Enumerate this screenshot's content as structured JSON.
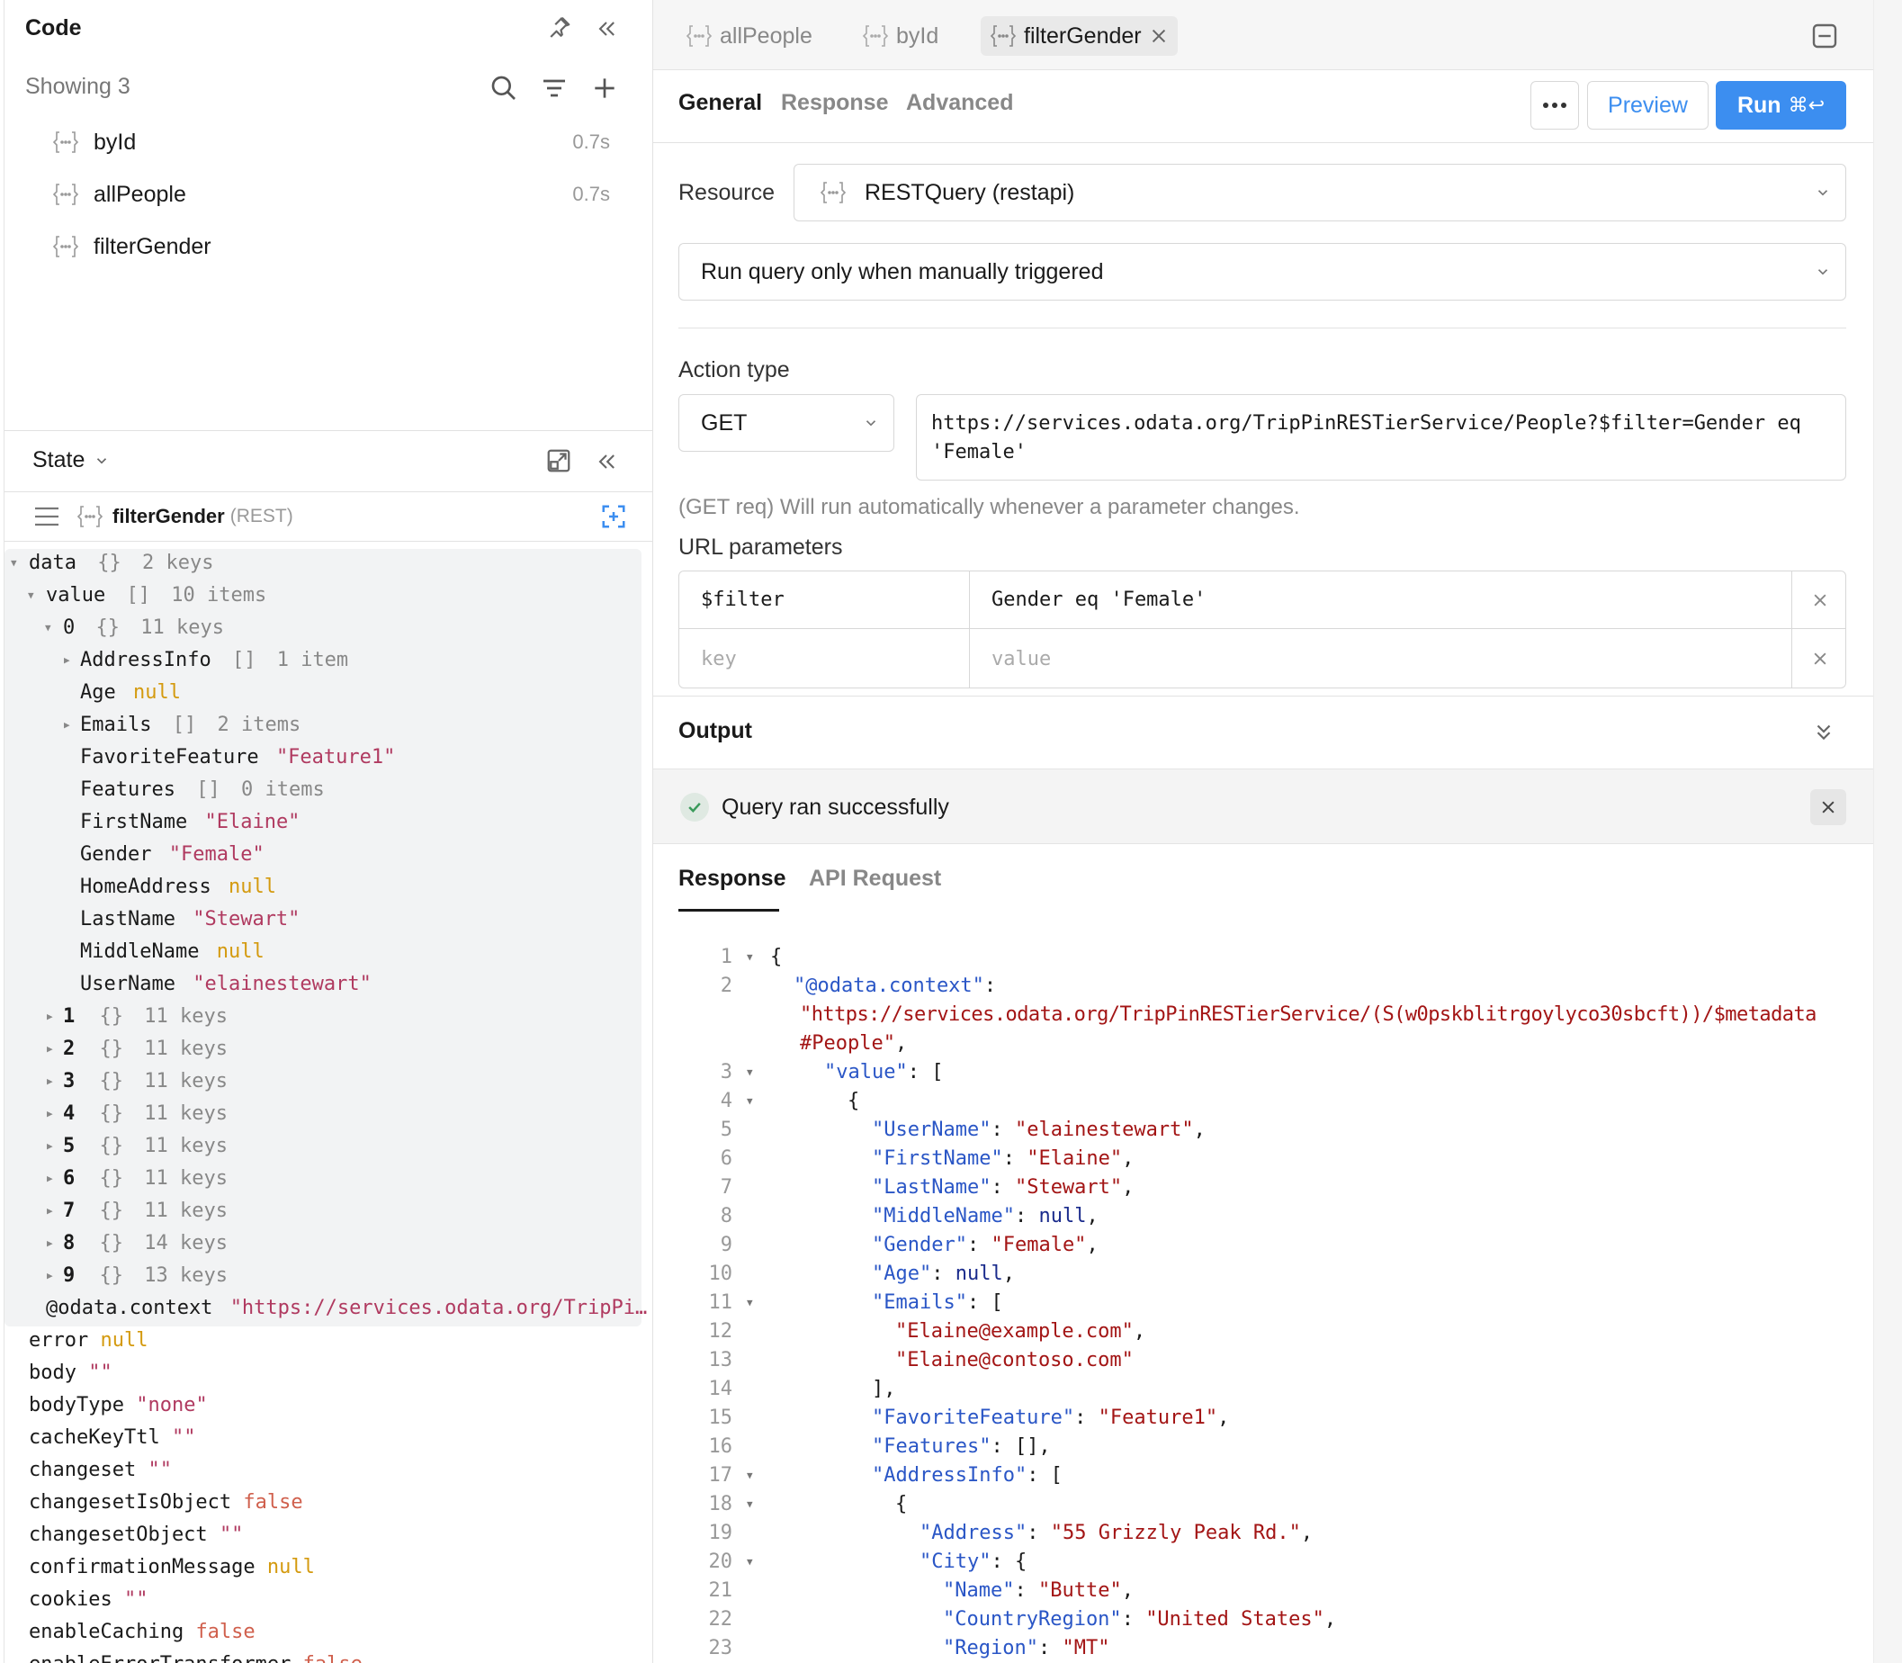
{
  "left": {
    "code_title": "Code",
    "showing": "Showing 3",
    "queries": [
      {
        "name": "byId",
        "time": "0.7s"
      },
      {
        "name": "allPeople",
        "time": "0.7s"
      },
      {
        "name": "filterGender",
        "time": ""
      }
    ],
    "state_title": "State",
    "selected": {
      "name": "filterGender",
      "type": "(REST)"
    },
    "tree": {
      "data": {
        "key": "data",
        "type": "{}",
        "count": "2 keys"
      },
      "value": {
        "key": "value",
        "type": "[]",
        "count": "10 items"
      },
      "item0": {
        "key": "0",
        "type": "{}",
        "count": "11 keys"
      },
      "address_info": {
        "key": "AddressInfo",
        "type": "[]",
        "count": "1 item"
      },
      "age": {
        "key": "Age",
        "val": "null"
      },
      "emails": {
        "key": "Emails",
        "type": "[]",
        "count": "2 items"
      },
      "favorite_feature": {
        "key": "FavoriteFeature",
        "val": "\"Feature1\""
      },
      "features": {
        "key": "Features",
        "type": "[]",
        "count": "0 items"
      },
      "first_name": {
        "key": "FirstName",
        "val": "\"Elaine\""
      },
      "gender": {
        "key": "Gender",
        "val": "\"Female\""
      },
      "home_address": {
        "key": "HomeAddress",
        "val": "null"
      },
      "last_name": {
        "key": "LastName",
        "val": "\"Stewart\""
      },
      "middle_name": {
        "key": "MiddleName",
        "val": "null"
      },
      "user_name": {
        "key": "UserName",
        "val": "\"elainestewart\""
      },
      "items": [
        {
          "key": "1",
          "type": "{}",
          "count": "11 keys"
        },
        {
          "key": "2",
          "type": "{}",
          "count": "11 keys"
        },
        {
          "key": "3",
          "type": "{}",
          "count": "11 keys"
        },
        {
          "key": "4",
          "type": "{}",
          "count": "11 keys"
        },
        {
          "key": "5",
          "type": "{}",
          "count": "11 keys"
        },
        {
          "key": "6",
          "type": "{}",
          "count": "11 keys"
        },
        {
          "key": "7",
          "type": "{}",
          "count": "11 keys"
        },
        {
          "key": "8",
          "type": "{}",
          "count": "14 keys"
        },
        {
          "key": "9",
          "type": "{}",
          "count": "13 keys"
        }
      ],
      "odata_context": {
        "key": "@odata.context",
        "val": "\"https://services.odata.org/TripPi…"
      },
      "props": [
        {
          "key": "error",
          "val": "null",
          "kind": "null"
        },
        {
          "key": "body",
          "val": "\"\"",
          "kind": "str"
        },
        {
          "key": "bodyType",
          "val": "\"none\"",
          "kind": "str"
        },
        {
          "key": "cacheKeyTtl",
          "val": "\"\"",
          "kind": "str"
        },
        {
          "key": "changeset",
          "val": "\"\"",
          "kind": "str"
        },
        {
          "key": "changesetIsObject",
          "val": "false",
          "kind": "bool"
        },
        {
          "key": "changesetObject",
          "val": "\"\"",
          "kind": "str"
        },
        {
          "key": "confirmationMessage",
          "val": "null",
          "kind": "null"
        },
        {
          "key": "cookies",
          "val": "\"\"",
          "kind": "str"
        },
        {
          "key": "enableCaching",
          "val": "false",
          "kind": "bool"
        },
        {
          "key": "enableErrorTransformer",
          "val": "false",
          "kind": "bool"
        }
      ]
    }
  },
  "right": {
    "file_tabs": [
      {
        "label": "allPeople"
      },
      {
        "label": "byId"
      },
      {
        "label": "filterGender"
      }
    ],
    "sub_tabs": [
      "General",
      "Response",
      "Advanced"
    ],
    "preview_label": "Preview",
    "run_label": "Run",
    "run_shortcut": "⌘↩",
    "resource_label": "Resource",
    "resource_value": "RESTQuery (restapi)",
    "trigger_value": "Run query only when manually triggered",
    "action_type_label": "Action type",
    "method_value": "GET",
    "url_line1": "https://services.odata.org/TripPinRESTierService/People?$filter=Gender eq",
    "url_line2": "'Female'",
    "get_note": "(GET req) Will run automatically whenever a parameter changes.",
    "url_params_label": "URL parameters",
    "params": [
      {
        "key": "$filter",
        "value": "Gender eq 'Female'"
      }
    ],
    "param_key_placeholder": "key",
    "param_value_placeholder": "value",
    "output_label": "Output",
    "success_text": "Query ran successfully",
    "response_tabs": [
      "Response",
      "API Request"
    ]
  },
  "colors": {
    "accent": "#3c8ef0",
    "success": "#3a9a5b"
  }
}
